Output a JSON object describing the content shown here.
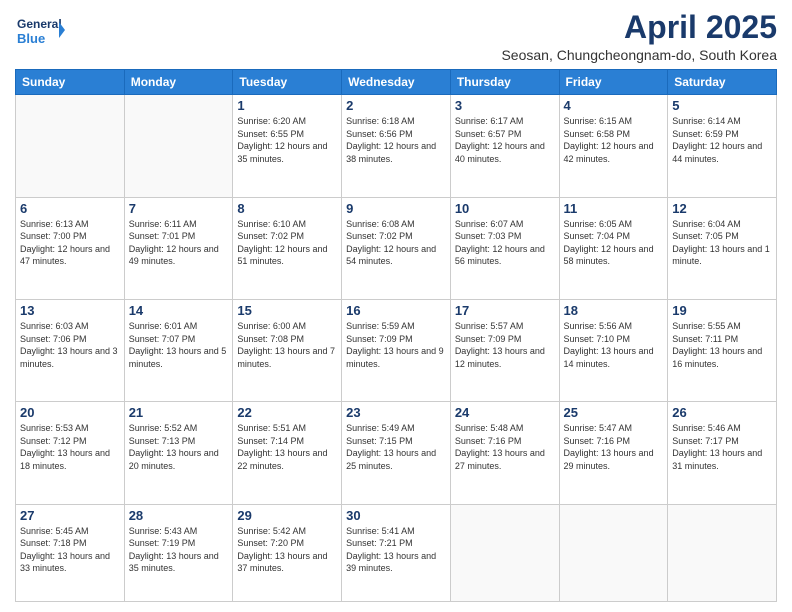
{
  "logo": {
    "line1": "General",
    "line2": "Blue"
  },
  "title": "April 2025",
  "subtitle": "Seosan, Chungcheongnam-do, South Korea",
  "days_header": [
    "Sunday",
    "Monday",
    "Tuesday",
    "Wednesday",
    "Thursday",
    "Friday",
    "Saturday"
  ],
  "weeks": [
    [
      {
        "day": "",
        "info": ""
      },
      {
        "day": "",
        "info": ""
      },
      {
        "day": "1",
        "info": "Sunrise: 6:20 AM\nSunset: 6:55 PM\nDaylight: 12 hours\nand 35 minutes."
      },
      {
        "day": "2",
        "info": "Sunrise: 6:18 AM\nSunset: 6:56 PM\nDaylight: 12 hours\nand 38 minutes."
      },
      {
        "day": "3",
        "info": "Sunrise: 6:17 AM\nSunset: 6:57 PM\nDaylight: 12 hours\nand 40 minutes."
      },
      {
        "day": "4",
        "info": "Sunrise: 6:15 AM\nSunset: 6:58 PM\nDaylight: 12 hours\nand 42 minutes."
      },
      {
        "day": "5",
        "info": "Sunrise: 6:14 AM\nSunset: 6:59 PM\nDaylight: 12 hours\nand 44 minutes."
      }
    ],
    [
      {
        "day": "6",
        "info": "Sunrise: 6:13 AM\nSunset: 7:00 PM\nDaylight: 12 hours\nand 47 minutes."
      },
      {
        "day": "7",
        "info": "Sunrise: 6:11 AM\nSunset: 7:01 PM\nDaylight: 12 hours\nand 49 minutes."
      },
      {
        "day": "8",
        "info": "Sunrise: 6:10 AM\nSunset: 7:02 PM\nDaylight: 12 hours\nand 51 minutes."
      },
      {
        "day": "9",
        "info": "Sunrise: 6:08 AM\nSunset: 7:02 PM\nDaylight: 12 hours\nand 54 minutes."
      },
      {
        "day": "10",
        "info": "Sunrise: 6:07 AM\nSunset: 7:03 PM\nDaylight: 12 hours\nand 56 minutes."
      },
      {
        "day": "11",
        "info": "Sunrise: 6:05 AM\nSunset: 7:04 PM\nDaylight: 12 hours\nand 58 minutes."
      },
      {
        "day": "12",
        "info": "Sunrise: 6:04 AM\nSunset: 7:05 PM\nDaylight: 13 hours\nand 1 minute."
      }
    ],
    [
      {
        "day": "13",
        "info": "Sunrise: 6:03 AM\nSunset: 7:06 PM\nDaylight: 13 hours\nand 3 minutes."
      },
      {
        "day": "14",
        "info": "Sunrise: 6:01 AM\nSunset: 7:07 PM\nDaylight: 13 hours\nand 5 minutes."
      },
      {
        "day": "15",
        "info": "Sunrise: 6:00 AM\nSunset: 7:08 PM\nDaylight: 13 hours\nand 7 minutes."
      },
      {
        "day": "16",
        "info": "Sunrise: 5:59 AM\nSunset: 7:09 PM\nDaylight: 13 hours\nand 9 minutes."
      },
      {
        "day": "17",
        "info": "Sunrise: 5:57 AM\nSunset: 7:09 PM\nDaylight: 13 hours\nand 12 minutes."
      },
      {
        "day": "18",
        "info": "Sunrise: 5:56 AM\nSunset: 7:10 PM\nDaylight: 13 hours\nand 14 minutes."
      },
      {
        "day": "19",
        "info": "Sunrise: 5:55 AM\nSunset: 7:11 PM\nDaylight: 13 hours\nand 16 minutes."
      }
    ],
    [
      {
        "day": "20",
        "info": "Sunrise: 5:53 AM\nSunset: 7:12 PM\nDaylight: 13 hours\nand 18 minutes."
      },
      {
        "day": "21",
        "info": "Sunrise: 5:52 AM\nSunset: 7:13 PM\nDaylight: 13 hours\nand 20 minutes."
      },
      {
        "day": "22",
        "info": "Sunrise: 5:51 AM\nSunset: 7:14 PM\nDaylight: 13 hours\nand 22 minutes."
      },
      {
        "day": "23",
        "info": "Sunrise: 5:49 AM\nSunset: 7:15 PM\nDaylight: 13 hours\nand 25 minutes."
      },
      {
        "day": "24",
        "info": "Sunrise: 5:48 AM\nSunset: 7:16 PM\nDaylight: 13 hours\nand 27 minutes."
      },
      {
        "day": "25",
        "info": "Sunrise: 5:47 AM\nSunset: 7:16 PM\nDaylight: 13 hours\nand 29 minutes."
      },
      {
        "day": "26",
        "info": "Sunrise: 5:46 AM\nSunset: 7:17 PM\nDaylight: 13 hours\nand 31 minutes."
      }
    ],
    [
      {
        "day": "27",
        "info": "Sunrise: 5:45 AM\nSunset: 7:18 PM\nDaylight: 13 hours\nand 33 minutes."
      },
      {
        "day": "28",
        "info": "Sunrise: 5:43 AM\nSunset: 7:19 PM\nDaylight: 13 hours\nand 35 minutes."
      },
      {
        "day": "29",
        "info": "Sunrise: 5:42 AM\nSunset: 7:20 PM\nDaylight: 13 hours\nand 37 minutes."
      },
      {
        "day": "30",
        "info": "Sunrise: 5:41 AM\nSunset: 7:21 PM\nDaylight: 13 hours\nand 39 minutes."
      },
      {
        "day": "",
        "info": ""
      },
      {
        "day": "",
        "info": ""
      },
      {
        "day": "",
        "info": ""
      }
    ]
  ]
}
